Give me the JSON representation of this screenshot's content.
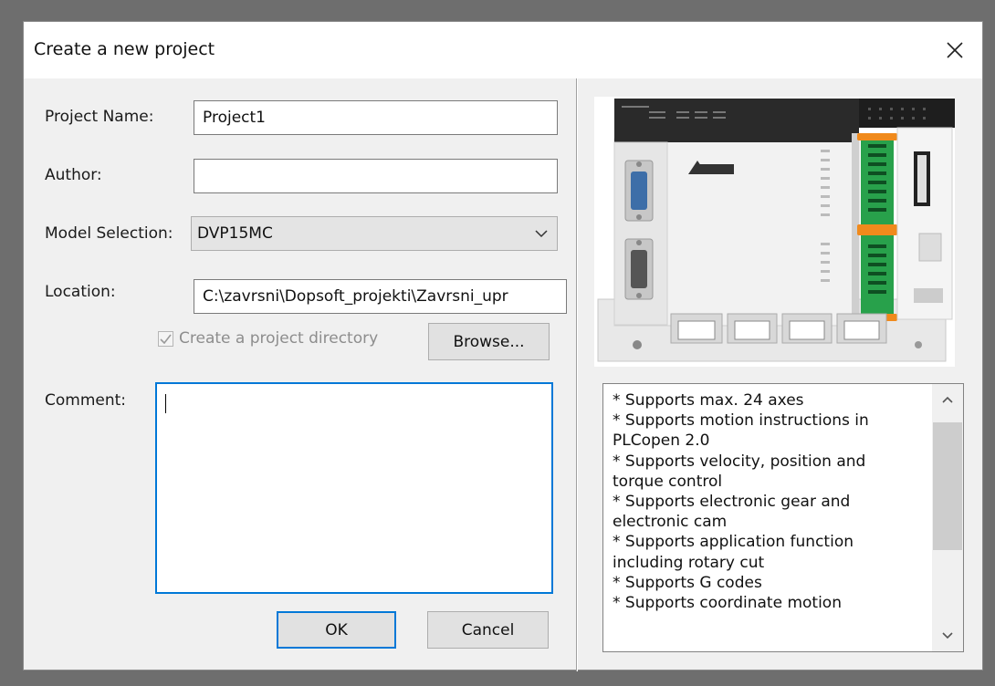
{
  "dialog": {
    "title": "Create a new project",
    "close_glyph": "×"
  },
  "form": {
    "project_name_label": "Project Name:",
    "project_name_value": "Project1",
    "author_label": "Author:",
    "author_value": "",
    "model_label": "Model Selection:",
    "model_value": "DVP15MC",
    "location_label": "Location:",
    "location_value": "C:\\zavrsni\\Dopsoft_projekti\\Zavrsni_upr",
    "create_dir_label": "Create a project directory",
    "create_dir_checked": true,
    "browse_label": "Browse...",
    "comment_label": "Comment:",
    "comment_value": "",
    "ok_label": "OK",
    "cancel_label": "Cancel"
  },
  "product": {
    "image_name": "DVP15MC PLC controller photo",
    "description_lines": [
      "* Supports max. 24 axes",
      "* Supports motion instructions in",
      "PLCopen 2.0",
      "* Supports velocity, position and",
      "torque control",
      "* Supports electronic gear and",
      "electronic cam",
      "* Supports application function",
      "including rotary cut",
      "* Supports G codes",
      "* Supports coordinate motion"
    ]
  },
  "icons": {
    "close": "close-icon",
    "dropdown": "chevron-down-icon",
    "check": "checkmark-icon",
    "scroll_up": "scroll-up-arrow-icon",
    "scroll_down": "scroll-down-arrow-icon"
  },
  "colors": {
    "accent": "#0078d7",
    "dialog_bg": "#f0f0f0",
    "backdrop": "#6e6e6e"
  }
}
